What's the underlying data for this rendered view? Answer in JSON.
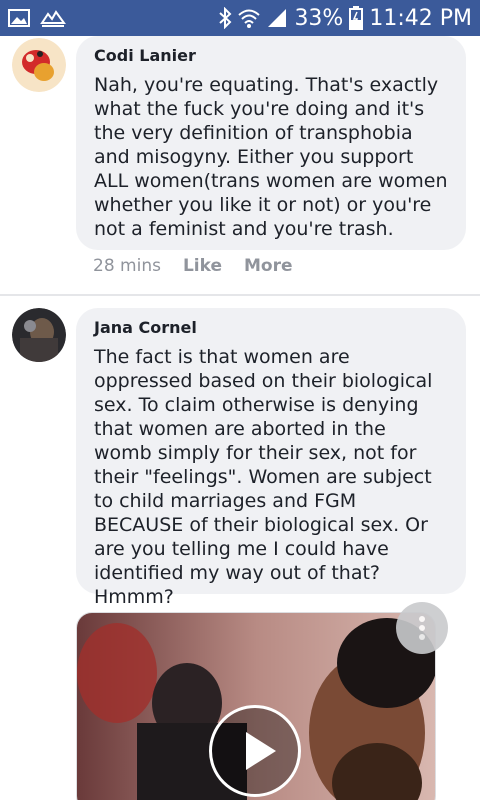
{
  "status_bar": {
    "battery": "33%",
    "time": "11:42 PM"
  },
  "comments": [
    {
      "author": "Codi Lanier",
      "text": "Nah, you're equating. That's exactly what the fuck you're doing and it's the very definition of transphobia and misogyny. Either you support ALL women(trans women are women whether you like it or not) or you're not a feminist and you're trash.",
      "time": "28 mins",
      "like_label": "Like",
      "more_label": "More"
    },
    {
      "author": "Jana Cornel",
      "text": "The fact is that women are oppressed based on their biological sex. To claim otherwise is denying that women are aborted in the womb simply for their sex, not for their \"feelings\". Women are subject to child marriages and FGM BECAUSE of their biological sex. Or are you telling me I could have identified my way out of that? Hmmm?"
    }
  ],
  "icons": {
    "status_left": [
      "image-icon",
      "notification-icon"
    ],
    "status_right": [
      "bluetooth-icon",
      "wifi-icon",
      "signal-icon",
      "battery-icon"
    ],
    "video": [
      "play-icon",
      "more-options-icon"
    ]
  },
  "colors": {
    "status_bar": "#3b5a9a",
    "bubble": "#f0f1f4",
    "meta_text": "#90949c"
  }
}
